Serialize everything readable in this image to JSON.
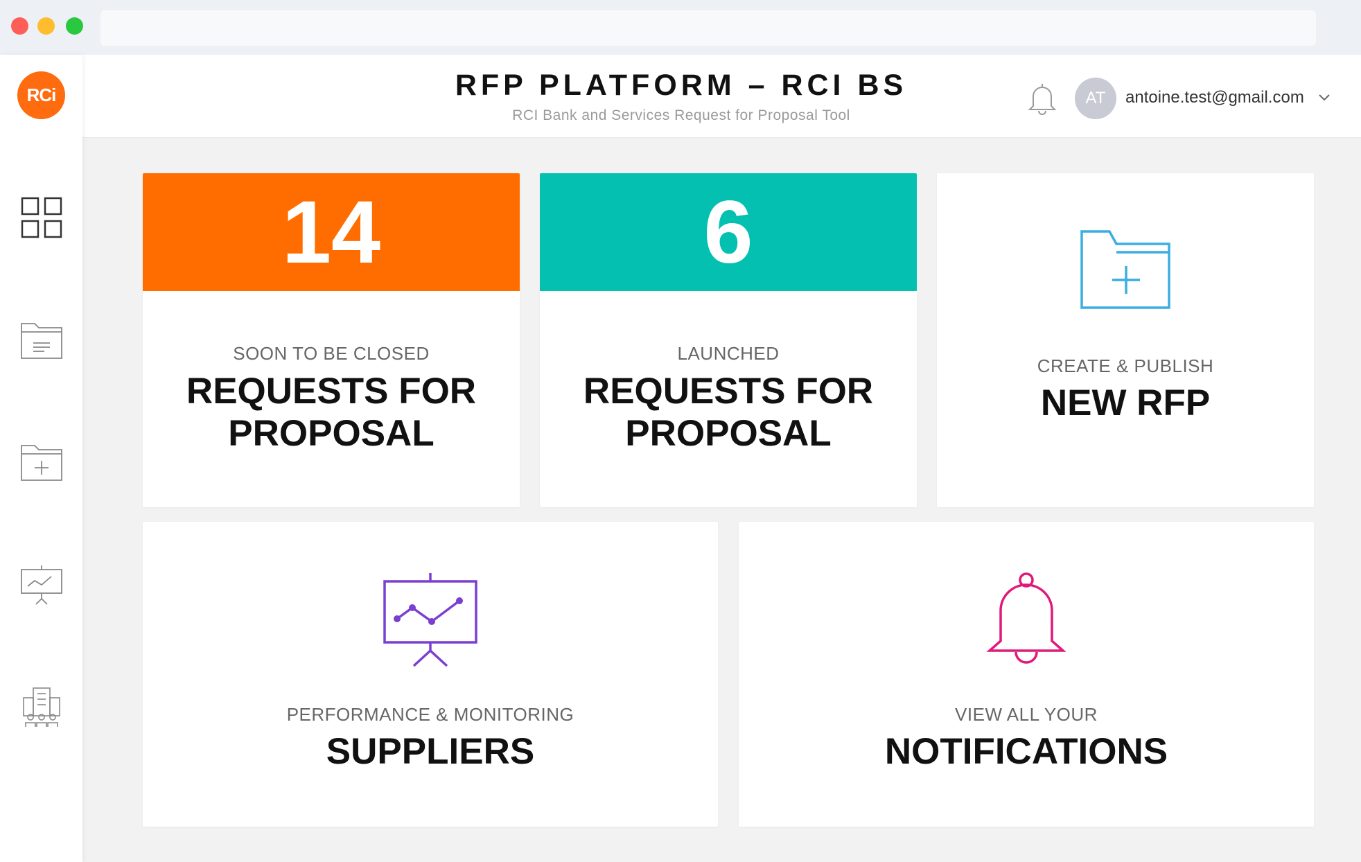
{
  "header": {
    "title": "RFP PLATFORM – RCI BS",
    "subtitle": "RCI Bank and Services Request for Proposal Tool",
    "user_initials": "AT",
    "user_email": "antoine.test@gmail.com"
  },
  "sidebar": {
    "logo_text": "RCi",
    "items": [
      {
        "icon": "dashboard-grid-icon"
      },
      {
        "icon": "folder-document-icon"
      },
      {
        "icon": "folder-add-icon"
      },
      {
        "icon": "presentation-chart-icon"
      },
      {
        "icon": "buildings-people-icon"
      }
    ]
  },
  "cards": {
    "soon_closed": {
      "count": "14",
      "subtitle": "SOON TO BE CLOSED",
      "line1": "REQUESTS FOR",
      "line2": "PROPOSAL",
      "color": "#ff6d00"
    },
    "launched": {
      "count": "6",
      "subtitle": "LAUNCHED",
      "line1": "REQUESTS FOR",
      "line2": "PROPOSAL",
      "color": "#04c0b0"
    },
    "new_rfp": {
      "subtitle": "CREATE & PUBLISH",
      "title": "NEW RFP",
      "icon": "folder-add-icon",
      "color": "#3aaee0"
    },
    "suppliers": {
      "subtitle": "PERFORMANCE & MONITORING",
      "title": "SUPPLIERS",
      "icon": "presentation-chart-icon",
      "color": "#7a3fd1"
    },
    "notifications": {
      "subtitle": "VIEW ALL YOUR",
      "title": "NOTIFICATIONS",
      "icon": "bell-icon",
      "color": "#e0197a"
    }
  }
}
